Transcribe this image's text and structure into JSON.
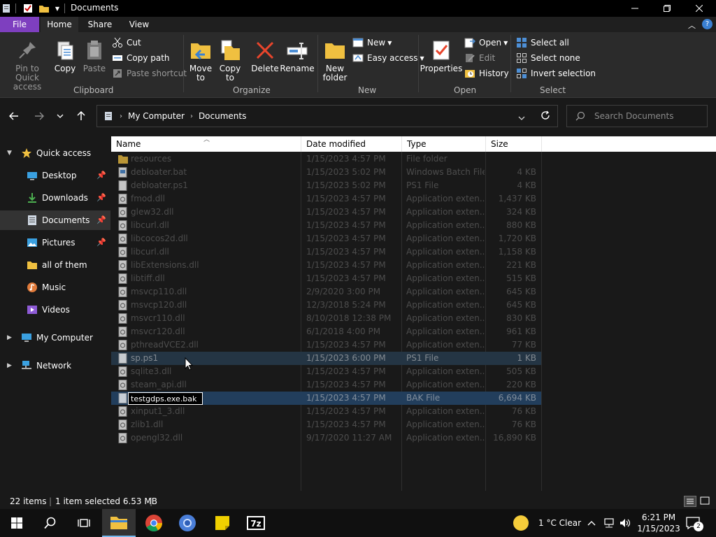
{
  "window": {
    "title": "Documents"
  },
  "tabs": [
    {
      "label": "File"
    },
    {
      "label": "Home"
    },
    {
      "label": "Share"
    },
    {
      "label": "View"
    }
  ],
  "ribbon": {
    "clipboard": {
      "pin_label": "Pin to Quick access",
      "copy_label": "Copy",
      "paste_label": "Paste",
      "cut_label": "Cut",
      "copy_path_label": "Copy path",
      "paste_shortcut_label": "Paste shortcut",
      "group_label": "Clipboard"
    },
    "organize": {
      "move_to_label": "Move to",
      "copy_to_label": "Copy to",
      "delete_label": "Delete",
      "rename_label": "Rename",
      "group_label": "Organize"
    },
    "new": {
      "new_folder_label": "New folder",
      "new_item_label": "New",
      "easy_access_label": "Easy access",
      "group_label": "New"
    },
    "open": {
      "properties_label": "Properties",
      "open_label": "Open",
      "edit_label": "Edit",
      "history_label": "History",
      "group_label": "Open"
    },
    "select": {
      "select_all_label": "Select all",
      "select_none_label": "Select none",
      "invert_label": "Invert selection",
      "group_label": "Select"
    }
  },
  "address": {
    "crumbs": [
      "My Computer",
      "Documents"
    ],
    "search_placeholder": "Search Documents"
  },
  "nav": [
    {
      "label": "Quick access",
      "icon": "star-icon",
      "pinned": false
    },
    {
      "label": "Desktop",
      "icon": "desktop-icon",
      "pinned": true
    },
    {
      "label": "Downloads",
      "icon": "download-icon",
      "pinned": true
    },
    {
      "label": "Documents",
      "icon": "documents-icon",
      "pinned": true
    },
    {
      "label": "Pictures",
      "icon": "pictures-icon",
      "pinned": true
    },
    {
      "label": "all of them",
      "icon": "folder-icon",
      "pinned": false
    },
    {
      "label": "Music",
      "icon": "music-icon",
      "pinned": false
    },
    {
      "label": "Videos",
      "icon": "videos-icon",
      "pinned": false
    },
    {
      "label": "My Computer",
      "icon": "computer-icon",
      "pinned": false
    },
    {
      "label": "Network",
      "icon": "network-icon",
      "pinned": false
    }
  ],
  "columns": {
    "name": "Name",
    "date": "Date modified",
    "type": "Type",
    "size": "Size"
  },
  "files": [
    {
      "name": "resources",
      "date": "1/15/2023 4:57 PM",
      "type": "File folder",
      "size": ""
    },
    {
      "name": "debloater.bat",
      "date": "1/15/2023 5:02 PM",
      "type": "Windows Batch File",
      "size": "4 KB"
    },
    {
      "name": "debloater.ps1",
      "date": "1/15/2023 5:02 PM",
      "type": "PS1 File",
      "size": "4 KB"
    },
    {
      "name": "fmod.dll",
      "date": "1/15/2023 4:57 PM",
      "type": "Application exten...",
      "size": "1,437 KB"
    },
    {
      "name": "glew32.dll",
      "date": "1/15/2023 4:57 PM",
      "type": "Application exten...",
      "size": "324 KB"
    },
    {
      "name": "libcurl.dll",
      "date": "1/15/2023 4:57 PM",
      "type": "Application exten...",
      "size": "880 KB"
    },
    {
      "name": "libcocos2d.dll",
      "date": "1/15/2023 4:57 PM",
      "type": "Application exten...",
      "size": "1,720 KB"
    },
    {
      "name": "libcurl.dll",
      "date": "1/15/2023 4:57 PM",
      "type": "Application exten...",
      "size": "1,158 KB"
    },
    {
      "name": "libExtensions.dll",
      "date": "1/15/2023 4:57 PM",
      "type": "Application exten...",
      "size": "221 KB"
    },
    {
      "name": "libtiff.dll",
      "date": "1/15/2023 4:57 PM",
      "type": "Application exten...",
      "size": "515 KB"
    },
    {
      "name": "msvcp110.dll",
      "date": "2/9/2020 3:00 PM",
      "type": "Application exten...",
      "size": "645 KB"
    },
    {
      "name": "msvcp120.dll",
      "date": "12/3/2018 5:24 PM",
      "type": "Application exten...",
      "size": "645 KB"
    },
    {
      "name": "msvcr110.dll",
      "date": "8/10/2018 12:38 PM",
      "type": "Application exten...",
      "size": "830 KB"
    },
    {
      "name": "msvcr120.dll",
      "date": "6/1/2018 4:00 PM",
      "type": "Application exten...",
      "size": "961 KB"
    },
    {
      "name": "pthreadVCE2.dll",
      "date": "1/15/2023 4:57 PM",
      "type": "Application exten...",
      "size": "77 KB"
    },
    {
      "name": "sp.ps1",
      "date": "1/15/2023 6:00 PM",
      "type": "PS1 File",
      "size": "1 KB"
    },
    {
      "name": "sqlite3.dll",
      "date": "1/15/2023 4:57 PM",
      "type": "Application exten...",
      "size": "505 KB"
    },
    {
      "name": "steam_api.dll",
      "date": "1/15/2023 4:57 PM",
      "type": "Application exten...",
      "size": "220 KB"
    },
    {
      "name": "testgdps.exe.bak",
      "date": "1/15/2023 4:57 PM",
      "type": "BAK File",
      "size": "6,694 KB"
    },
    {
      "name": "xinput1_3.dll",
      "date": "1/15/2023 4:57 PM",
      "type": "Application exten...",
      "size": "76 KB"
    },
    {
      "name": "zlib1.dll",
      "date": "1/15/2023 4:57 PM",
      "type": "Application exten...",
      "size": "76 KB"
    },
    {
      "name": "opengl32.dll",
      "date": "9/17/2020 11:27 AM",
      "type": "Application exten...",
      "size": "16,890 KB"
    }
  ],
  "rename_value": "testgdps.exe.bak",
  "status": {
    "items": "22 items",
    "selected": "1 item selected  6.53 MB"
  },
  "taskbar": {
    "weather": "1 °C  Clear",
    "time": "6:21 PM",
    "date": "1/15/2023",
    "notification_count": "2"
  },
  "colors": {
    "file_tab": "#7e3fbf",
    "selection": "#223e5c",
    "hover": "#243544",
    "folder": "#f0c040"
  }
}
